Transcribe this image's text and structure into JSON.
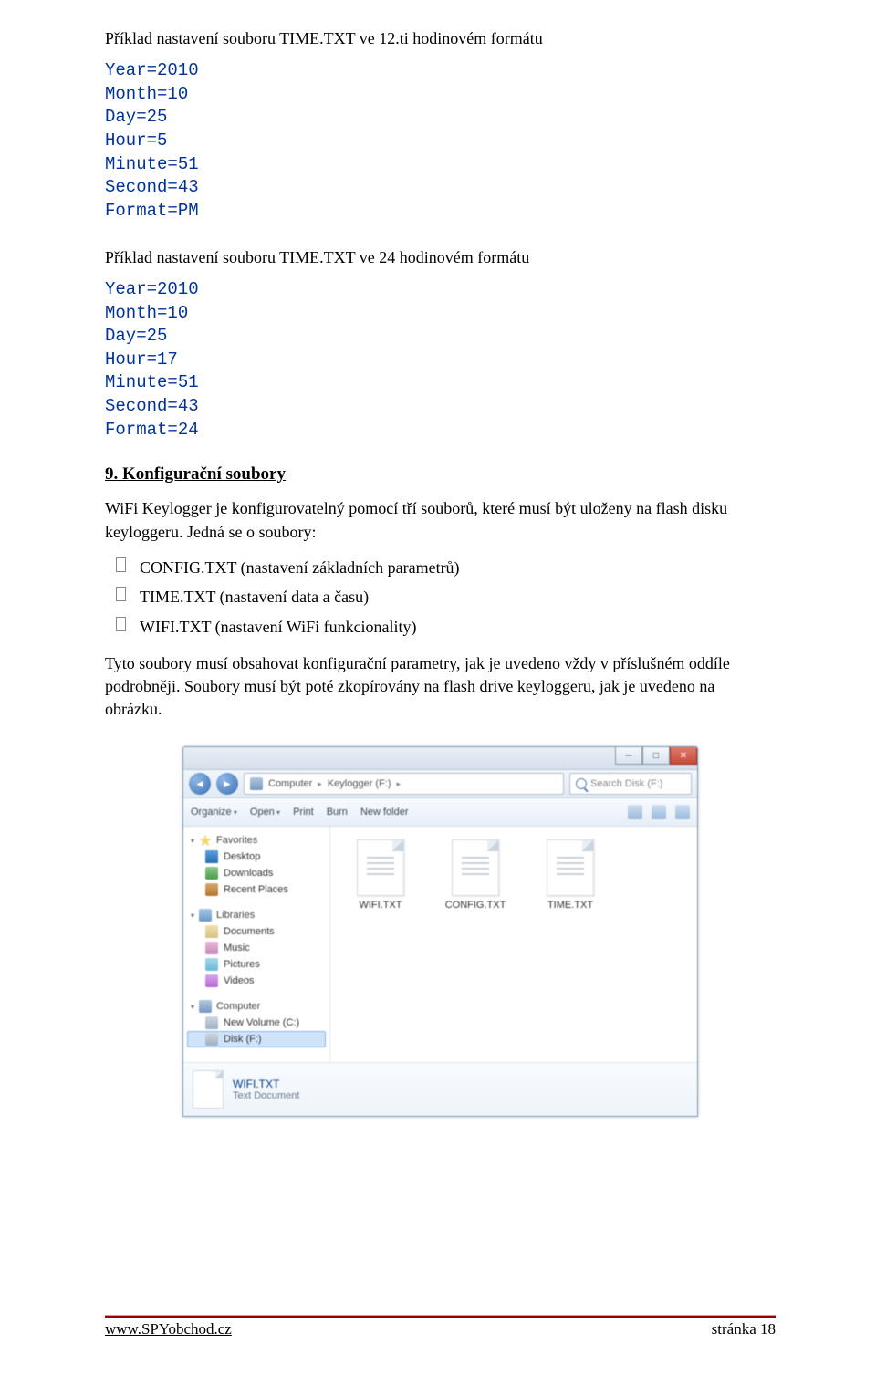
{
  "text": {
    "heading1": "Příklad nastavení souboru TIME.TXT ve 12.ti hodinovém formátu",
    "heading2": "Příklad nastavení souboru TIME.TXT ve 24 hodinovém formátu",
    "section_num": "9. ",
    "section_title": "Konfigurační soubory",
    "para1": "WiFi Keylogger je konfigurovatelný pomocí tří souborů, které musí být uloženy na flash disku keyloggeru. Jedná se o soubory:",
    "bullets": [
      "CONFIG.TXT (nastavení základních parametrů)",
      "TIME.TXT (nastavení data a času)",
      "WIFI.TXT (nastavení WiFi funkcionality)"
    ],
    "para2": "Tyto soubory musí obsahovat konfigurační parametry, jak je uvedeno vždy v příslušném oddíle podrobněji. Soubory musí být poté zkopírovány na flash drive keyloggeru, jak je uvedeno na obrázku."
  },
  "mono1": "Year=2010\nMonth=10\nDay=25\nHour=5\nMinute=51\nSecond=43\nFormat=PM",
  "mono2": "Year=2010\nMonth=10\nDay=25\nHour=17\nMinute=51\nSecond=43\nFormat=24",
  "explorer": {
    "breadcrumb": [
      "Computer",
      "Keylogger (F:)"
    ],
    "search_placeholder": "Search Disk (F:)",
    "toolbar": {
      "organize": "Organize",
      "open": "Open",
      "print": "Print",
      "burn": "Burn",
      "newfolder": "New folder"
    },
    "sidebar": {
      "favorites": "Favorites",
      "fav_items": [
        "Desktop",
        "Downloads",
        "Recent Places"
      ],
      "libraries": "Libraries",
      "lib_items": [
        "Documents",
        "Music",
        "Pictures",
        "Videos"
      ],
      "computer": "Computer",
      "comp_items": [
        "New Volume (C:)",
        "Disk (F:)"
      ]
    },
    "files": [
      "WIFI.TXT",
      "CONFIG.TXT",
      "TIME.TXT"
    ],
    "details": {
      "name": "WIFI.TXT",
      "type": "Text Document"
    }
  },
  "footer": {
    "site": "www.SPYobchod.cz",
    "page": "stránka 18"
  }
}
